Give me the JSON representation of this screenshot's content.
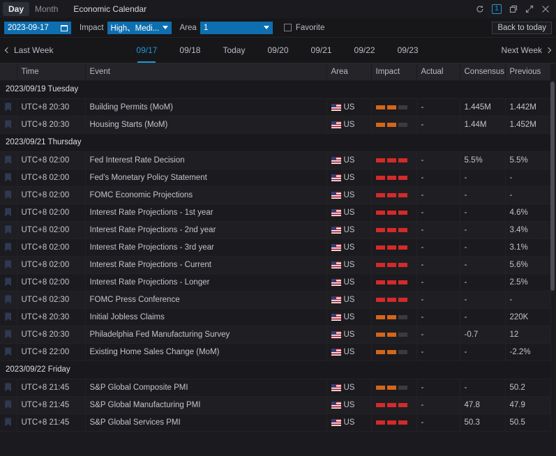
{
  "titlebar": {
    "modes": [
      {
        "label": "Day",
        "active": true
      },
      {
        "label": "Month",
        "active": false
      }
    ],
    "window_title": "Economic Calendar",
    "controls": [
      {
        "name": "refresh-icon",
        "glyph": "↻"
      },
      {
        "name": "window-count-badge",
        "glyph": "1"
      },
      {
        "name": "restore-icon",
        "glyph": "❐"
      },
      {
        "name": "expand-icon",
        "glyph": "⤢"
      },
      {
        "name": "close-icon",
        "glyph": "✕"
      }
    ]
  },
  "toolbar": {
    "date_value": "2023-09-17",
    "calendar_icon": "calendar-icon",
    "impact_label": "Impact",
    "impact_value": "High、Medi...",
    "area_label": "Area",
    "area_value": "1",
    "favorite_label": "Favorite",
    "favorite_checked": false,
    "back_to_today_label": "Back to today"
  },
  "weeknav": {
    "prev_label": "Last Week",
    "next_label": "Next Week",
    "days": [
      {
        "label": "09/17",
        "active": true
      },
      {
        "label": "09/18",
        "active": false
      },
      {
        "label": "Today",
        "active": false
      },
      {
        "label": "09/20",
        "active": false
      },
      {
        "label": "09/21",
        "active": false
      },
      {
        "label": "09/22",
        "active": false
      },
      {
        "label": "09/23",
        "active": false
      }
    ]
  },
  "table": {
    "columns": [
      "",
      "Time",
      "Event",
      "Area",
      "Impact",
      "Actual",
      "Consensus",
      "Previous"
    ],
    "groups": [
      {
        "date_label": "2023/09/19 Tuesday",
        "rows": [
          {
            "time": "UTC+8 20:30",
            "event": "Building Permits (MoM)",
            "area": "US",
            "impact": "medium",
            "actual": "-",
            "consensus": "1.445M",
            "previous": "1.442M"
          },
          {
            "time": "UTC+8 20:30",
            "event": "Housing Starts (MoM)",
            "area": "US",
            "impact": "medium",
            "actual": "-",
            "consensus": "1.44M",
            "previous": "1.452M"
          }
        ]
      },
      {
        "date_label": "2023/09/21 Thursday",
        "rows": [
          {
            "time": "UTC+8 02:00",
            "event": "Fed Interest Rate Decision",
            "area": "US",
            "impact": "high",
            "actual": "-",
            "consensus": "5.5%",
            "previous": "5.5%"
          },
          {
            "time": "UTC+8 02:00",
            "event": "Fed's Monetary Policy Statement",
            "area": "US",
            "impact": "high",
            "actual": "-",
            "consensus": "-",
            "previous": "-"
          },
          {
            "time": "UTC+8 02:00",
            "event": "FOMC Economic Projections",
            "area": "US",
            "impact": "high",
            "actual": "-",
            "consensus": "-",
            "previous": "-"
          },
          {
            "time": "UTC+8 02:00",
            "event": "Interest Rate Projections - 1st year",
            "area": "US",
            "impact": "high",
            "actual": "-",
            "consensus": "-",
            "previous": "4.6%"
          },
          {
            "time": "UTC+8 02:00",
            "event": "Interest Rate Projections - 2nd year",
            "area": "US",
            "impact": "high",
            "actual": "-",
            "consensus": "-",
            "previous": "3.4%"
          },
          {
            "time": "UTC+8 02:00",
            "event": "Interest Rate Projections - 3rd year",
            "area": "US",
            "impact": "high",
            "actual": "-",
            "consensus": "-",
            "previous": "3.1%"
          },
          {
            "time": "UTC+8 02:00",
            "event": "Interest Rate Projections - Current",
            "area": "US",
            "impact": "high",
            "actual": "-",
            "consensus": "-",
            "previous": "5.6%"
          },
          {
            "time": "UTC+8 02:00",
            "event": "Interest Rate Projections - Longer",
            "area": "US",
            "impact": "high",
            "actual": "-",
            "consensus": "-",
            "previous": "2.5%"
          },
          {
            "time": "UTC+8 02:30",
            "event": "FOMC Press Conference",
            "area": "US",
            "impact": "high",
            "actual": "-",
            "consensus": "-",
            "previous": "-"
          },
          {
            "time": "UTC+8 20:30",
            "event": "Initial Jobless Claims",
            "area": "US",
            "impact": "medium",
            "actual": "-",
            "consensus": "-",
            "previous": "220K"
          },
          {
            "time": "UTC+8 20:30",
            "event": "Philadelphia Fed Manufacturing Survey",
            "area": "US",
            "impact": "medium",
            "actual": "-",
            "consensus": "-0.7",
            "previous": "12"
          },
          {
            "time": "UTC+8 22:00",
            "event": "Existing Home Sales Change (MoM)",
            "area": "US",
            "impact": "medium",
            "actual": "-",
            "consensus": "-",
            "previous": "-2.2%"
          }
        ]
      },
      {
        "date_label": "2023/09/22 Friday",
        "rows": [
          {
            "time": "UTC+8 21:45",
            "event": "S&P Global Composite PMI",
            "area": "US",
            "impact": "medium",
            "actual": "-",
            "consensus": "-",
            "previous": "50.2"
          },
          {
            "time": "UTC+8 21:45",
            "event": "S&P Global Manufacturing PMI",
            "area": "US",
            "impact": "high",
            "actual": "-",
            "consensus": "47.8",
            "previous": "47.9"
          },
          {
            "time": "UTC+8 21:45",
            "event": "S&P Global Services PMI",
            "area": "US",
            "impact": "high",
            "actual": "-",
            "consensus": "50.3",
            "previous": "50.5"
          }
        ]
      }
    ]
  },
  "colors": {
    "accent": "#2196d8",
    "field_blue": "#0e6fb0",
    "impact_high": "#d42a2a",
    "impact_medium": "#d4661a",
    "impact_empty": "#3a3a3f",
    "background": "#1b1b1f"
  }
}
